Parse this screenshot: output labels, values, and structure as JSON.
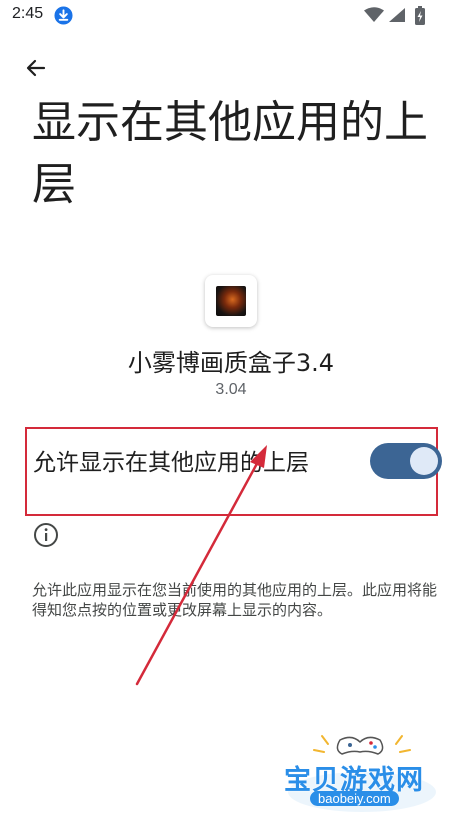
{
  "status_bar": {
    "time": "2:45",
    "icons": [
      "download-icon",
      "wifi-icon",
      "signal-icon",
      "battery-icon"
    ]
  },
  "header": {
    "back_icon": "arrow-back-icon",
    "title": "显示在其他应用的上层"
  },
  "app": {
    "name": "小雾博画质盒子3.4",
    "version": "3.04"
  },
  "permission": {
    "label": "允许显示在其他应用的上层",
    "enabled": true
  },
  "info": {
    "icon": "info-icon",
    "description": "允许此应用显示在您当前使用的其他应用的上层。此应用将能得知您点按的位置或更改屏幕上显示的内容。"
  },
  "watermark": {
    "text": "宝贝游戏网",
    "url": "baobeiy.com"
  },
  "colors": {
    "accent": "#3c6594",
    "highlight_border": "#d42a3a",
    "arrow": "#d42a3a",
    "watermark": "#2a8ee8"
  }
}
